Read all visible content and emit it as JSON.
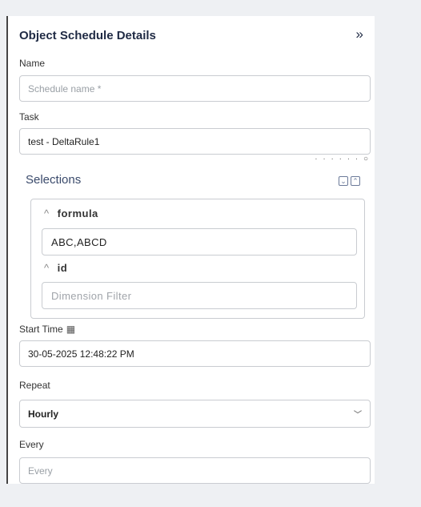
{
  "panel": {
    "title": "Object Schedule Details",
    "collapse_icon": "»"
  },
  "name": {
    "label": "Name",
    "placeholder": "Schedule name *"
  },
  "task": {
    "label": "Task",
    "value": "test - DeltaRule1"
  },
  "hint": "· · · · · · ○",
  "selections": {
    "title": "Selections",
    "expand_icon": "⌄",
    "collapse_icon": "⌃",
    "formula": {
      "label": "formula",
      "value": "ABC,ABCD"
    },
    "id": {
      "label": "id",
      "placeholder": "Dimension Filter"
    }
  },
  "start_time": {
    "label": "Start Time",
    "value": "30-05-2025 12:48:22 PM"
  },
  "repeat": {
    "label": "Repeat",
    "value": "Hourly"
  },
  "every": {
    "label": "Every",
    "placeholder": "Every"
  }
}
